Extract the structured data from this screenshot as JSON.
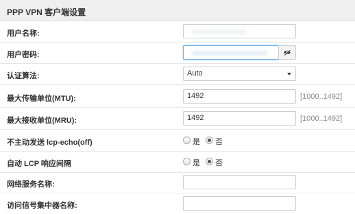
{
  "panel": {
    "title": "PPP VPN 客户端设置"
  },
  "fields": {
    "username": {
      "label": "用户名称:",
      "value": ""
    },
    "password": {
      "label": "用户密码:",
      "value": ""
    },
    "auth": {
      "label": "认证算法:",
      "selected": "Auto"
    },
    "mtu": {
      "label": "最大传输单位(MTU):",
      "value": "1492",
      "hint": "[1000..1492]"
    },
    "mru": {
      "label": "最大接收单位(MRU):",
      "value": "1492",
      "hint": "[1000..1492]"
    },
    "lcp_echo_off": {
      "label": "不主动发送 lcp-echo(off)",
      "yes": "是",
      "no": "否",
      "selected": "no"
    },
    "auto_lcp": {
      "label": "自动 LCP 响应间隔",
      "yes": "是",
      "no": "否",
      "selected": "no"
    },
    "service_name": {
      "label": "网络服务名称:",
      "value": ""
    },
    "ac_name": {
      "label": "访问信号集中器名称:",
      "value": ""
    }
  },
  "icons": {
    "password_toggle": "eye-slash-icon",
    "select_arrow": "chevron-down-icon"
  },
  "colors": {
    "header_bg": "#efefef",
    "focus_border": "#66afe9"
  }
}
